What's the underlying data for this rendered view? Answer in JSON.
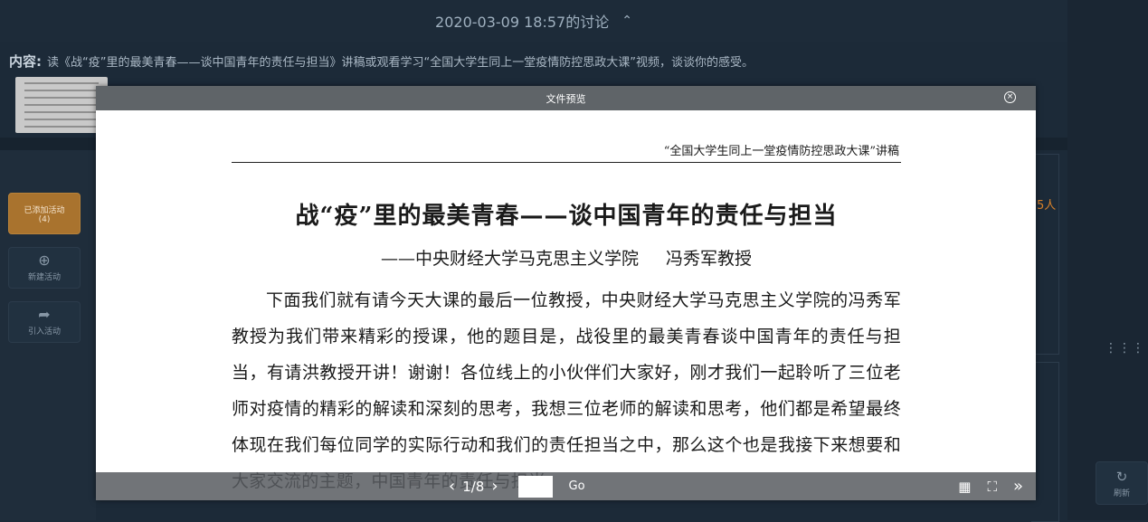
{
  "header": {
    "title": "2020-03-09 18:57的讨论",
    "toggle_icon": "chevron-up-icon"
  },
  "content": {
    "label": "内容:",
    "text": "读《战“疫”里的最美青春——谈中国青年的责任与担当》讲稿或观看学习“全国大学生同上一堂疫情防控思政大课”视频，谈谈你的感受。"
  },
  "background": {
    "count_fragment": "5人"
  },
  "sidebar": {
    "added": {
      "label": "已添加活动",
      "count": "(4)"
    },
    "new_activity": "新建活动",
    "import_activity": "引入活动",
    "refresh": "刷新"
  },
  "modal": {
    "title": "文件预览",
    "doc": {
      "header": "“全国大学生同上一堂疫情防控思政大课”讲稿",
      "title": "战“疫”里的最美青春——谈中国青年的责任与担当",
      "subtitle": "——中央财经大学马克思主义学院",
      "author": "冯秀军教授",
      "body": "下面我们就有请今天大课的最后一位教授，中央财经大学马克思主义学院的冯秀军教授为我们带来精彩的授课，他的题目是，战役里的最美青春谈中国青年的责任与担当，有请洪教授开讲！谢谢！各位线上的小伙伴们大家好，刚才我们一起聆听了三位老师对疫情的精彩的解读和深刻的思考，我想三位老师的解读和思考，他们都是希望最终体现在我们每位同学的实际行动和我们的责任担当之中，那么这个也是我接下来想要和大家交流的主题，中国青年的责任与担当。"
    },
    "viewer": {
      "page_indicator": "1/8",
      "page_input_value": "",
      "go_label": "Go"
    }
  },
  "colors": {
    "accent": "#a9732e",
    "modal_header": "#5f6468",
    "background": "#1c2a38"
  }
}
